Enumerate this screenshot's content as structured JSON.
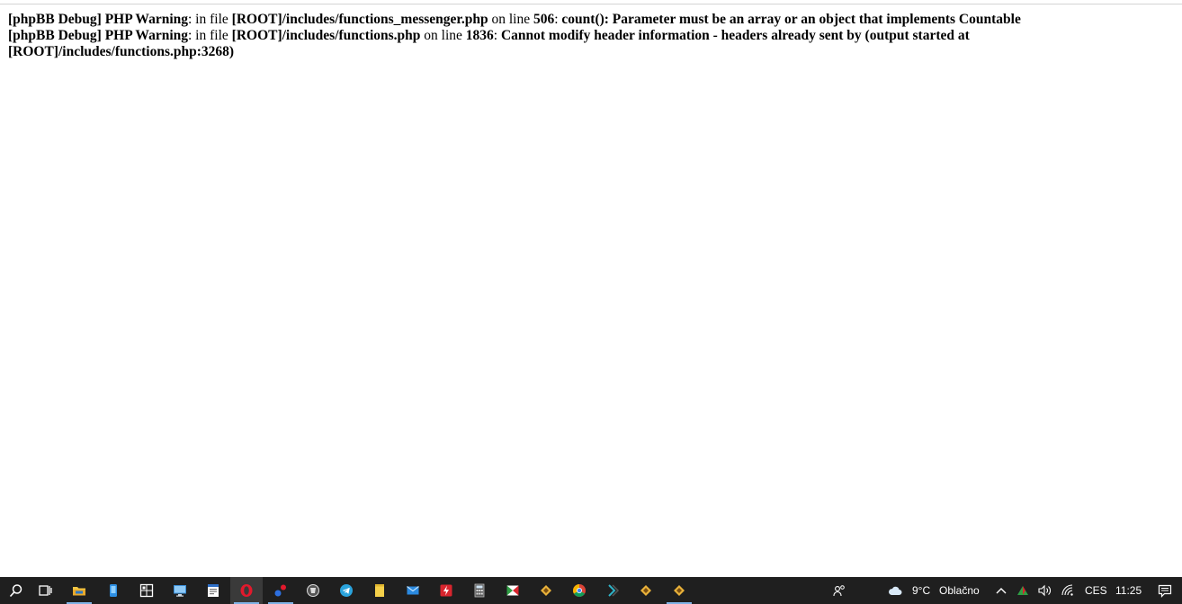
{
  "messages": [
    {
      "tag": "[phpBB Debug]",
      "level": "PHP Warning",
      "sep1": ": in file ",
      "file": "[ROOT]/includes/functions_messenger.php",
      "sep2": " on line ",
      "line": "506",
      "sep3": ": ",
      "text": "count(): Parameter must be an array or an object that implements Countable"
    },
    {
      "tag": "[phpBB Debug]",
      "level": "PHP Warning",
      "sep1": ": in file ",
      "file": "[ROOT]/includes/functions.php",
      "sep2": " on line ",
      "line": "1836",
      "sep3": ": ",
      "text": "Cannot modify header information - headers already sent by (output started at [ROOT]/includes/functions.php:3268)"
    }
  ],
  "taskbar": {
    "weather_temp": "9°C",
    "weather_desc": "Oblačno",
    "language": "CES",
    "clock": "11:25"
  },
  "colors": {
    "taskbar_bg": "#1f1f1f",
    "active_underline": "#7fb3e6"
  }
}
